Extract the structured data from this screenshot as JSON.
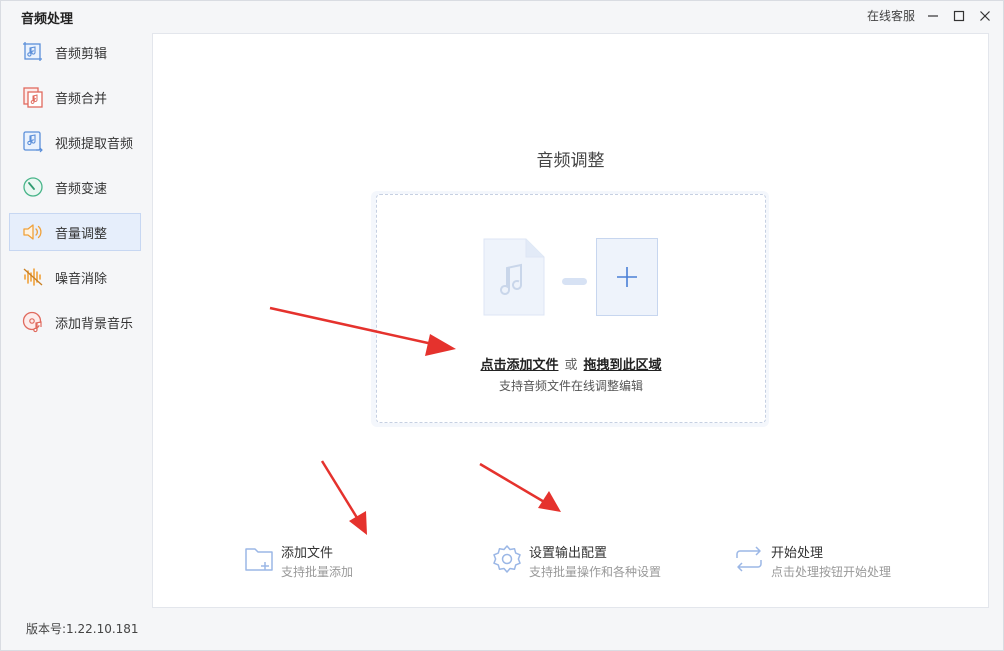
{
  "window": {
    "title": "音频处理",
    "service_label": "在线客服"
  },
  "sidebar": {
    "items": [
      {
        "label": "音频剪辑",
        "icon": "audio-cut-icon",
        "active": false
      },
      {
        "label": "音频合并",
        "icon": "audio-merge-icon",
        "active": false
      },
      {
        "label": "视频提取音频",
        "icon": "video-extract-audio-icon",
        "active": false
      },
      {
        "label": "音频变速",
        "icon": "audio-speed-icon",
        "active": false
      },
      {
        "label": "音量调整",
        "icon": "volume-icon",
        "active": true
      },
      {
        "label": "噪音消除",
        "icon": "noise-reduction-icon",
        "active": false
      },
      {
        "label": "添加背景音乐",
        "icon": "background-music-icon",
        "active": false
      }
    ]
  },
  "main": {
    "title": "音频调整",
    "drop": {
      "click_add": "点击添加文件",
      "or": "或",
      "drag_here": "拖拽到此区域",
      "hint": "支持音频文件在线调整编辑"
    },
    "actions": [
      {
        "title": "添加文件",
        "subtitle": "支持批量添加",
        "icon": "add-folder-icon"
      },
      {
        "title": "设置输出配置",
        "subtitle": "支持批量操作和各种设置",
        "icon": "gear-icon"
      },
      {
        "title": "开始处理",
        "subtitle": "点击处理按钮开始处理",
        "icon": "repeat-icon"
      }
    ]
  },
  "footer": {
    "version": "版本号:1.22.10.181"
  },
  "colors": {
    "accent": "#4a7fd6",
    "active_bg": "#e6eefb",
    "annotation_arrow": "#e5322d"
  }
}
